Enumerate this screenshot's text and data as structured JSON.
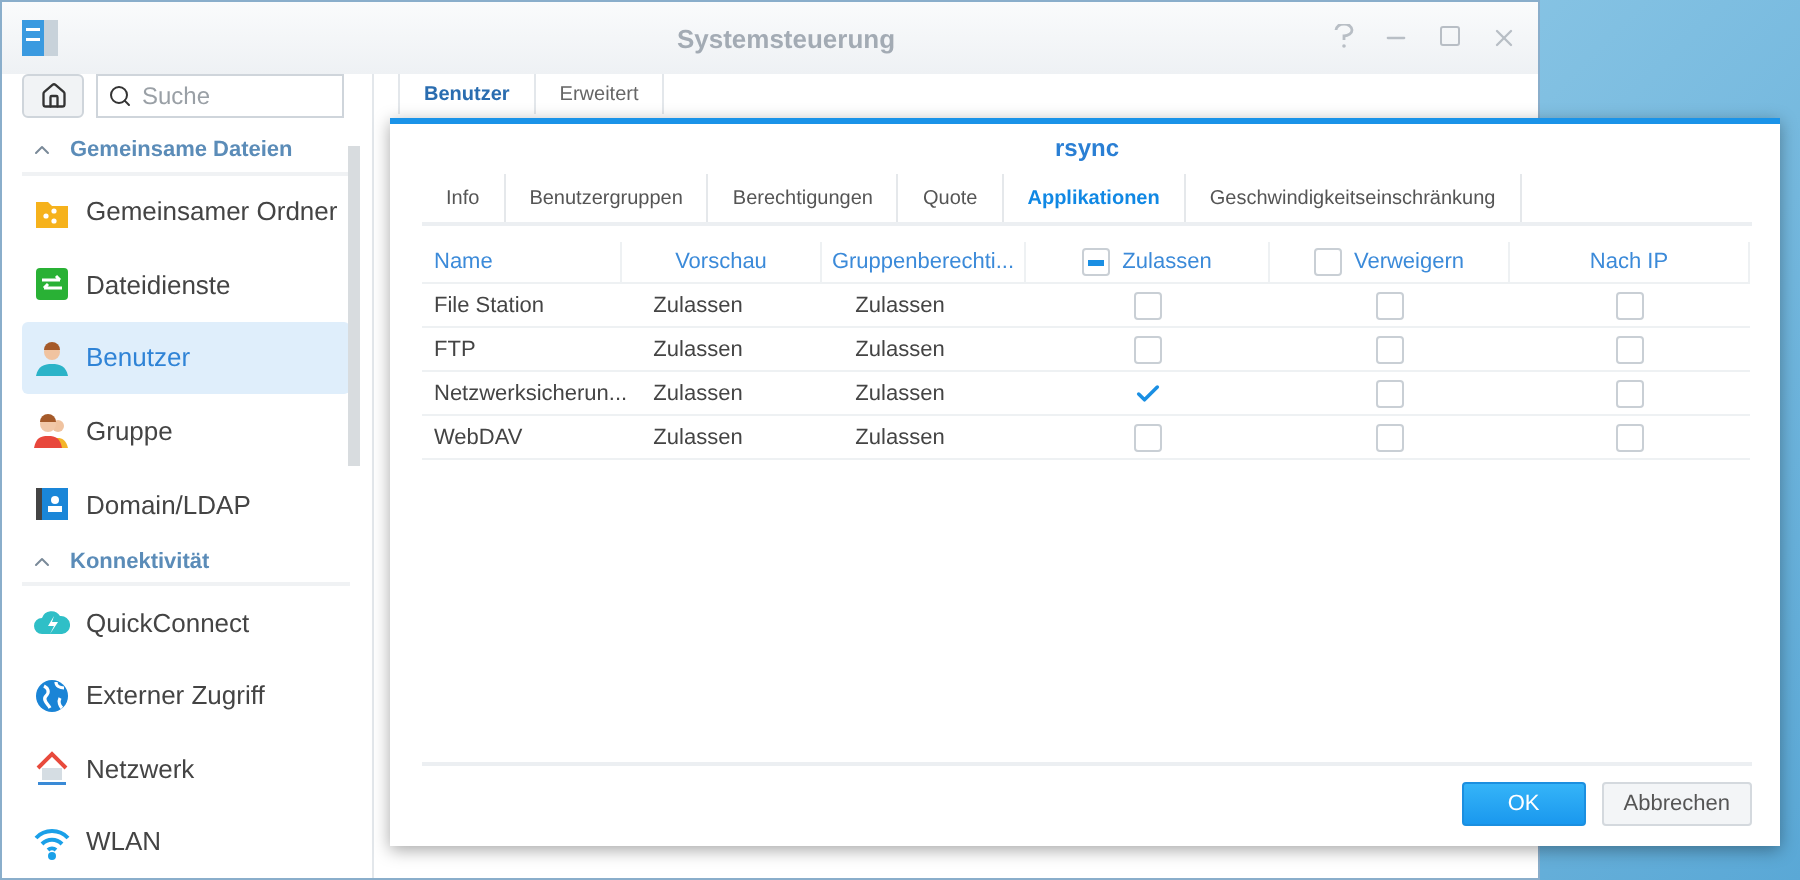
{
  "window": {
    "title": "Systemsteuerung"
  },
  "sidebar": {
    "search": {
      "placeholder": "Suche"
    },
    "sections": [
      {
        "title": "Gemeinsame Dateien",
        "expanded": true,
        "items": [
          {
            "label": "Gemeinsamer Ordner",
            "selected": false
          },
          {
            "label": "Dateidienste",
            "selected": false
          },
          {
            "label": "Benutzer",
            "selected": true
          },
          {
            "label": "Gruppe",
            "selected": false
          },
          {
            "label": "Domain/LDAP",
            "selected": false
          }
        ]
      },
      {
        "title": "Konnektivität",
        "expanded": true,
        "items": [
          {
            "label": "QuickConnect",
            "selected": false
          },
          {
            "label": "Externer Zugriff",
            "selected": false
          },
          {
            "label": "Netzwerk",
            "selected": false
          },
          {
            "label": "WLAN",
            "selected": false
          }
        ]
      }
    ]
  },
  "background_tabs": [
    {
      "label": "Benutzer",
      "selected": true
    },
    {
      "label": "Erweitert",
      "selected": false
    }
  ],
  "dialog": {
    "title": "rsync",
    "tabs": [
      {
        "label": "Info",
        "selected": false
      },
      {
        "label": "Benutzergruppen",
        "selected": false
      },
      {
        "label": "Berechtigungen",
        "selected": false
      },
      {
        "label": "Quote",
        "selected": false
      },
      {
        "label": "Applikationen",
        "selected": true
      },
      {
        "label": "Geschwindigkeitseinschränkung",
        "selected": false
      }
    ],
    "columns": [
      {
        "label": "Name",
        "kind": "text"
      },
      {
        "label": "Vorschau",
        "kind": "text"
      },
      {
        "label": "Gruppenberechti...",
        "kind": "text"
      },
      {
        "label": "Zulassen",
        "kind": "check",
        "mixed": true
      },
      {
        "label": "Verweigern",
        "kind": "check",
        "checked": false
      },
      {
        "label": "Nach IP",
        "kind": "check"
      }
    ],
    "rows": [
      {
        "cells": [
          "File Station",
          "Zulassen",
          "Zulassen"
        ],
        "checks": [
          false,
          false,
          false
        ]
      },
      {
        "cells": [
          "FTP",
          "Zulassen",
          "Zulassen"
        ],
        "checks": [
          false,
          false,
          false
        ]
      },
      {
        "cells": [
          "Netzwerksicherun...",
          "Zulassen",
          "Zulassen"
        ],
        "checks": [
          true,
          false,
          false
        ]
      },
      {
        "cells": [
          "WebDAV",
          "Zulassen",
          "Zulassen"
        ],
        "checks": [
          false,
          false,
          false
        ]
      }
    ],
    "buttons": [
      {
        "label": "OK",
        "kind": "primary"
      },
      {
        "label": "Abbrechen",
        "kind": "secondary"
      }
    ]
  }
}
